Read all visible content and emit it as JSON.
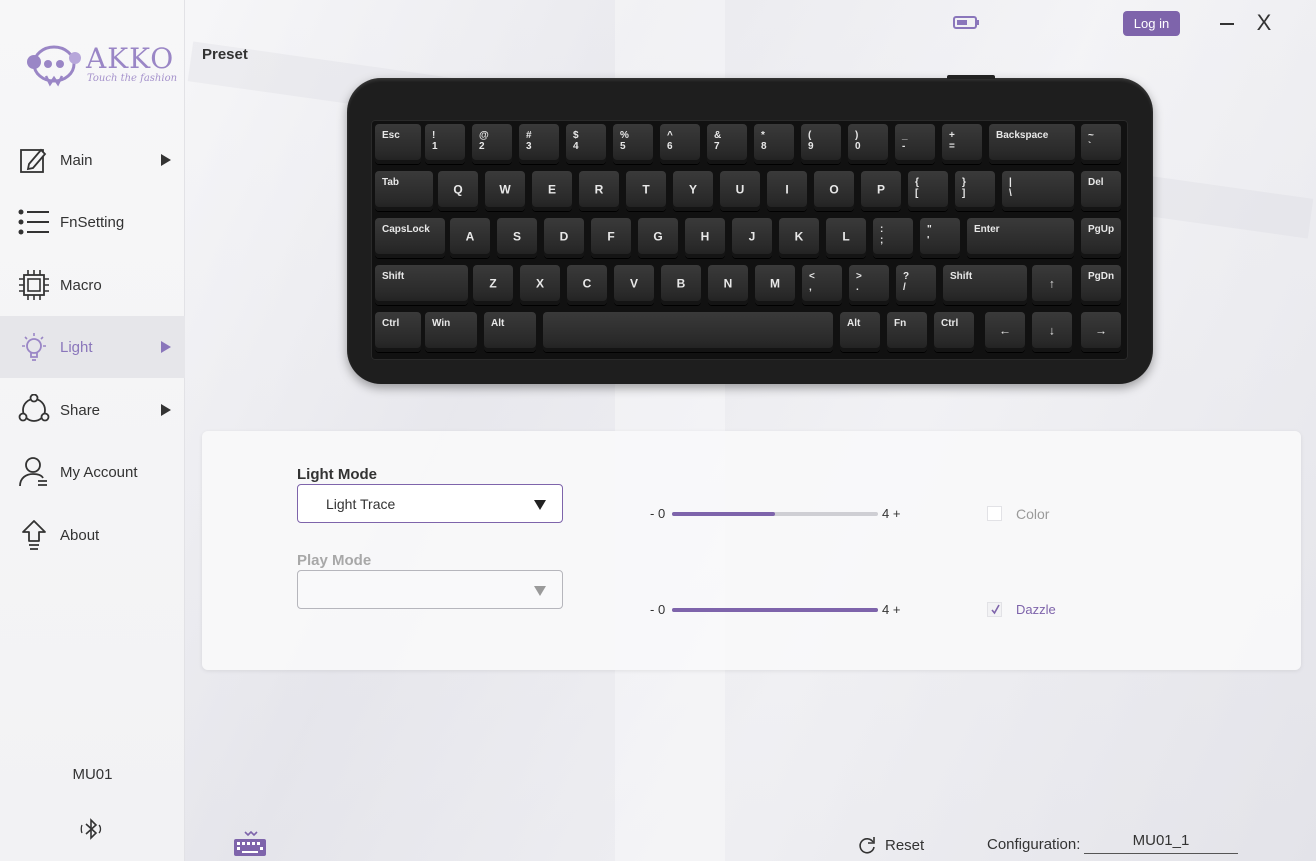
{
  "app": {
    "brand": "AKKO",
    "tagline": "Touch the fashion",
    "colors": {
      "accent": "#7e64ab",
      "text": "#333333",
      "muted": "#a8a8a8"
    }
  },
  "sidebar": {
    "items": [
      {
        "label": "Main",
        "icon": "edit-icon",
        "has_arrow": true
      },
      {
        "label": "FnSetting",
        "icon": "list-icon",
        "has_arrow": false
      },
      {
        "label": "Macro",
        "icon": "chip-icon",
        "has_arrow": false
      },
      {
        "label": "Light",
        "icon": "lightbulb-icon",
        "has_arrow": true,
        "active": true
      },
      {
        "label": "Share",
        "icon": "share-icon",
        "has_arrow": true
      },
      {
        "label": "My Account",
        "icon": "user-icon",
        "has_arrow": false
      },
      {
        "label": "About",
        "icon": "upload-arrow-icon",
        "has_arrow": false
      }
    ],
    "device_name": "MU01",
    "connection_icon": "bluetooth-icon"
  },
  "header": {
    "preset_label": "Preset",
    "login_label": "Log in",
    "close_label": "X",
    "battery_icon": "battery-icon"
  },
  "keyboard": {
    "rows": [
      [
        "Esc",
        "!\n1",
        "@\n2",
        "#\n3",
        "$\n4",
        "%\n5",
        "^\n6",
        "&\n7",
        "*\n8",
        "(\n9",
        ")\n0",
        "_\n-",
        "+\n=",
        "Backspace",
        "~\n`"
      ],
      [
        "Tab",
        "Q",
        "W",
        "E",
        "R",
        "T",
        "Y",
        "U",
        "I",
        "O",
        "P",
        "{\n[",
        "}\n]",
        "|\n\\",
        "Del"
      ],
      [
        "CapsLock",
        "A",
        "S",
        "D",
        "F",
        "G",
        "H",
        "J",
        "K",
        "L",
        ":\n;",
        "\"\n'",
        "Enter",
        "PgUp"
      ],
      [
        "Shift",
        "Z",
        "X",
        "C",
        "V",
        "B",
        "N",
        "M",
        "<\n,",
        ">\n.",
        "?\n/",
        "Shift",
        "↑",
        "PgDn"
      ],
      [
        "Ctrl",
        "Win",
        "Alt",
        "",
        "Alt",
        "Fn",
        "Ctrl",
        "←",
        "↓",
        "→"
      ]
    ]
  },
  "light_panel": {
    "light_mode": {
      "label": "Light Mode",
      "selected": "Light Trace"
    },
    "play_mode": {
      "label": "Play Mode",
      "selected": ""
    },
    "brightness_slider": {
      "min_label": "- 0",
      "max_label": "4 +",
      "value": 2,
      "max": 4
    },
    "speed_slider": {
      "min_label": "- 0",
      "max_label": "4 +",
      "value": 4,
      "max": 4
    },
    "color_option": {
      "label": "Color",
      "checked": false
    },
    "dazzle_option": {
      "label": "Dazzle",
      "checked": true
    }
  },
  "footer": {
    "reset_label": "Reset",
    "configuration_label": "Configuration:",
    "configuration_value": "MU01_1",
    "layout_icon": "keyboard-layout-icon"
  }
}
